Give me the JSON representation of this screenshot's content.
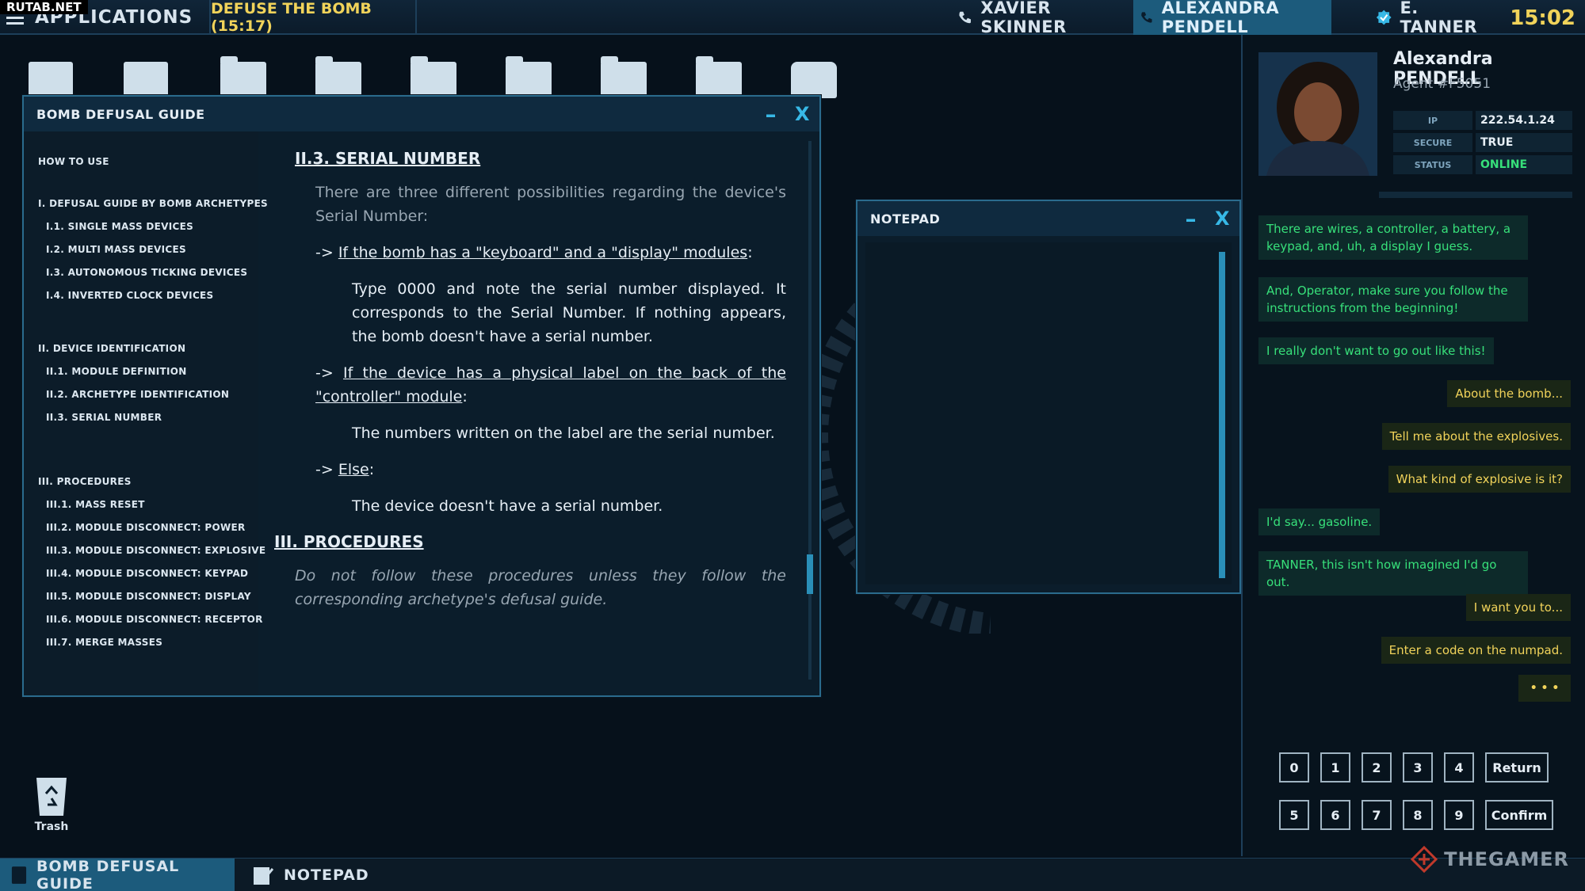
{
  "watermark": "RUTAB.NET",
  "topbar": {
    "apps_label": "APPLICATIONS",
    "mission": "DEFUSE THE BOMB (15:17)",
    "contacts": [
      {
        "name": "XAVIER SKINNER",
        "active": false
      },
      {
        "name": "ALEXANDRA PENDELL",
        "active": true
      },
      {
        "name": "E. TANNER",
        "active": false
      }
    ],
    "clock": "15:02"
  },
  "guide": {
    "title": "BOMB DEFUSAL GUIDE",
    "nav": [
      {
        "label": "HOW TO USE",
        "level": 0
      },
      {
        "label": "I. DEFUSAL GUIDE BY BOMB ARCHETYPES",
        "level": 0
      },
      {
        "label": "I.1. SINGLE MASS DEVICES",
        "level": 1
      },
      {
        "label": "I.2. MULTI MASS DEVICES",
        "level": 1
      },
      {
        "label": "I.3. AUTONOMOUS TICKING DEVICES",
        "level": 1
      },
      {
        "label": "I.4. INVERTED CLOCK DEVICES",
        "level": 1
      },
      {
        "label": "II. DEVICE IDENTIFICATION",
        "level": 0
      },
      {
        "label": "II.1. MODULE DEFINITION",
        "level": 1
      },
      {
        "label": "II.2. ARCHETYPE IDENTIFICATION",
        "level": 1
      },
      {
        "label": "II.3. SERIAL NUMBER",
        "level": 1
      },
      {
        "label": "III. PROCEDURES",
        "level": 0
      },
      {
        "label": "III.1. MASS RESET",
        "level": 1
      },
      {
        "label": "III.2. MODULE DISCONNECT: POWER",
        "level": 1
      },
      {
        "label": "III.3. MODULE DISCONNECT: EXPLOSIVE",
        "level": 1
      },
      {
        "label": "III.4. MODULE DISCONNECT: KEYPAD",
        "level": 1
      },
      {
        "label": "III.5. MODULE DISCONNECT: DISPLAY",
        "level": 1
      },
      {
        "label": "III.6. MODULE DISCONNECT: RECEPTOR",
        "level": 1
      },
      {
        "label": "III.7. MERGE MASSES",
        "level": 1
      }
    ],
    "content": {
      "section_title": "II.3. SERIAL NUMBER",
      "intro": "There are three different possibilities regarding the device's Serial Number:",
      "case1_arrow": "->",
      "case1_title": "If the bomb has a \"keyboard\" and a \"display\" modules",
      "case1_colon": ":",
      "case1_body": "Type 0000 and note the serial number displayed. It corresponds to the Serial Number. If nothing appears, the bomb doesn't have a serial number.",
      "case2_arrow": "->",
      "case2_title": "If the device has a physical label on the back of the \"controller\" module",
      "case2_colon": ":",
      "case2_body": "The numbers written on the label are the serial number.",
      "case3_arrow": "->",
      "case3_title": "Else",
      "case3_colon": ":",
      "case3_body": "The device doesn't have a serial number.",
      "next_title": "III. PROCEDURES",
      "next_body": "Do not follow these procedures unless they follow the corresponding archetype's defusal guide."
    }
  },
  "notepad": {
    "title": "NOTEPAD"
  },
  "window_controls": {
    "minimize": "–",
    "close": "X"
  },
  "agent": {
    "first_name": "Alexandra",
    "last_name": "PENDELL",
    "id": "Agent #F5051",
    "info": [
      {
        "key": "IP",
        "value": "222.54.1.24",
        "ok": false
      },
      {
        "key": "SECURE",
        "value": "TRUE",
        "ok": false
      },
      {
        "key": "STATUS",
        "value": "ONLINE",
        "ok": true
      }
    ]
  },
  "chat": [
    {
      "dir": "in",
      "text": "There are wires, a controller, a battery, a keypad, and, uh, a display I guess."
    },
    {
      "dir": "in",
      "text": "And, Operator, make sure you follow the instructions from the beginning!"
    },
    {
      "dir": "in",
      "text": "I really don't want to go out like this!"
    },
    {
      "dir": "out",
      "text": "About the bomb..."
    },
    {
      "dir": "out",
      "text": "Tell me about the explosives."
    },
    {
      "dir": "out",
      "text": "What kind of explosive is it?"
    },
    {
      "dir": "in",
      "text": "I'd say... gasoline."
    },
    {
      "dir": "in",
      "text": "TANNER, this isn't how imagined I'd go out."
    },
    {
      "dir": "out",
      "text": "I want you to..."
    },
    {
      "dir": "out",
      "text": "Enter a code on the numpad."
    },
    {
      "dir": "out",
      "text": "• • •"
    }
  ],
  "keypad": {
    "row1": [
      "0",
      "1",
      "2",
      "3",
      "4"
    ],
    "row2": [
      "5",
      "6",
      "7",
      "8",
      "9"
    ],
    "return_label": "Return",
    "confirm_label": "Confirm"
  },
  "desktop": {
    "trash_label": "Trash"
  },
  "taskbar": {
    "items": [
      {
        "label": "BOMB DEFUSAL GUIDE",
        "active": true
      },
      {
        "label": "NOTEPAD",
        "active": false
      }
    ]
  },
  "brand": "THEGAMER",
  "colors": {
    "accent": "#37b8e6",
    "active_tab": "#1c5b7c",
    "mission_yellow": "#f1d35a",
    "incoming_green": "#37e07a",
    "background": "#06111b"
  }
}
